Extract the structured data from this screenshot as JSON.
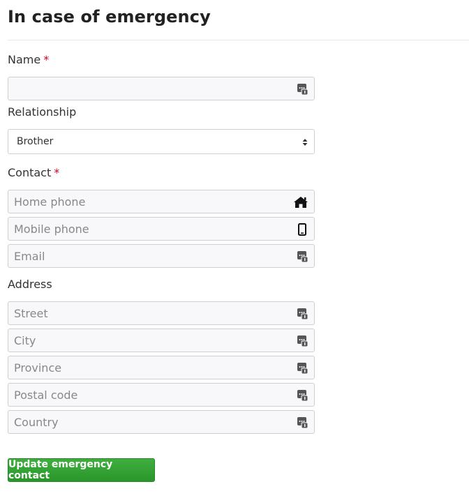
{
  "section": {
    "title": "In case of emergency"
  },
  "name": {
    "label": "Name",
    "required_mark": "*",
    "value": "",
    "icon": "autofill-icon"
  },
  "relationship": {
    "label": "Relationship",
    "selected": "Brother"
  },
  "contact": {
    "label": "Contact",
    "required_mark": "*",
    "home_phone": {
      "placeholder": "Home phone",
      "icon": "home-icon"
    },
    "mobile_phone": {
      "placeholder": "Mobile phone",
      "icon": "mobile-phone-icon"
    },
    "email": {
      "placeholder": "Email",
      "icon": "autofill-icon"
    }
  },
  "address": {
    "label": "Address",
    "street": {
      "placeholder": "Street",
      "icon": "autofill-icon"
    },
    "city": {
      "placeholder": "City",
      "icon": "autofill-icon"
    },
    "province": {
      "placeholder": "Province",
      "icon": "autofill-icon"
    },
    "postal_code": {
      "placeholder": "Postal code",
      "icon": "autofill-icon"
    },
    "country": {
      "placeholder": "Country",
      "icon": "autofill-icon"
    }
  },
  "submit": {
    "label": "Update emergency contact"
  },
  "colors": {
    "required": "#d0021b",
    "button": "#2f9e2f",
    "field_bg": "#f8f8fa",
    "field_border": "#cfcfcf"
  }
}
